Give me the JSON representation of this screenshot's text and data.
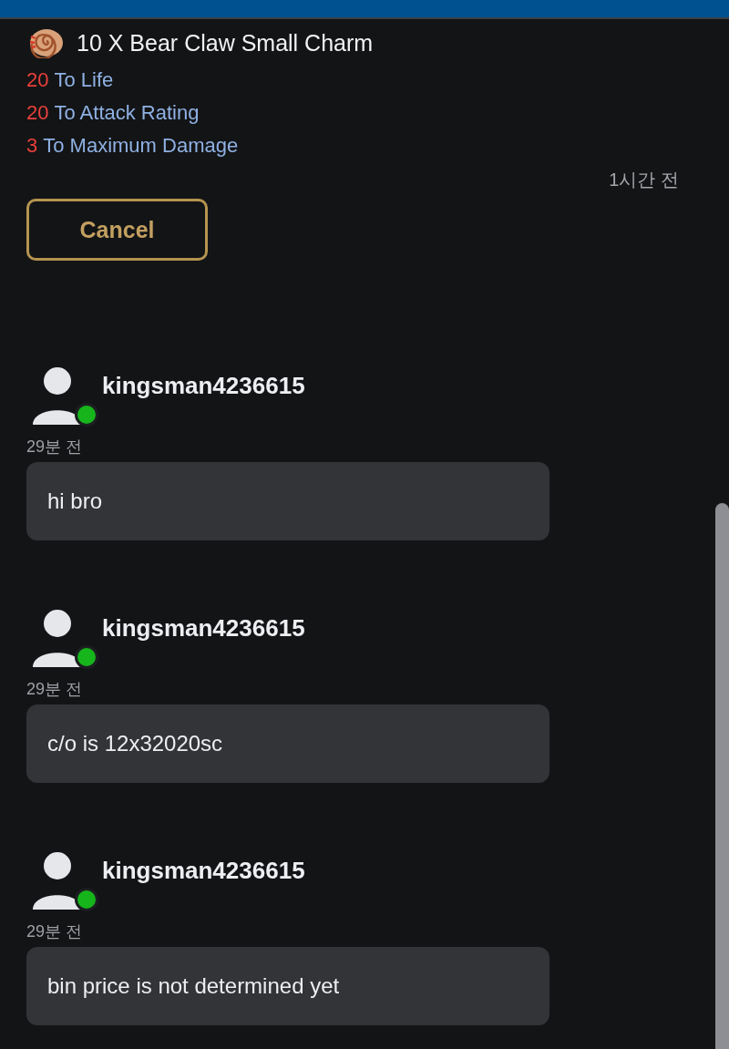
{
  "listing": {
    "title": "10 X Bear Claw Small Charm",
    "stats": [
      {
        "bonus": "20",
        "stat": "To Life"
      },
      {
        "bonus": "20",
        "stat": "To Attack Rating"
      },
      {
        "bonus": "3",
        "stat": "To Maximum Damage"
      }
    ],
    "time": "1시간 전",
    "cancel_button": "Cancel"
  },
  "messages": [
    {
      "user": "kingsman4236615",
      "online": true,
      "time": "29분 전",
      "text": "hi bro"
    },
    {
      "user": "kingsman4236615",
      "online": true,
      "time": "29분 전",
      "text": "c/o is 12x32020sc"
    },
    {
      "user": "kingsman4236615",
      "online": true,
      "time": "29분 전",
      "text": "bin price is not determined yet"
    }
  ]
}
